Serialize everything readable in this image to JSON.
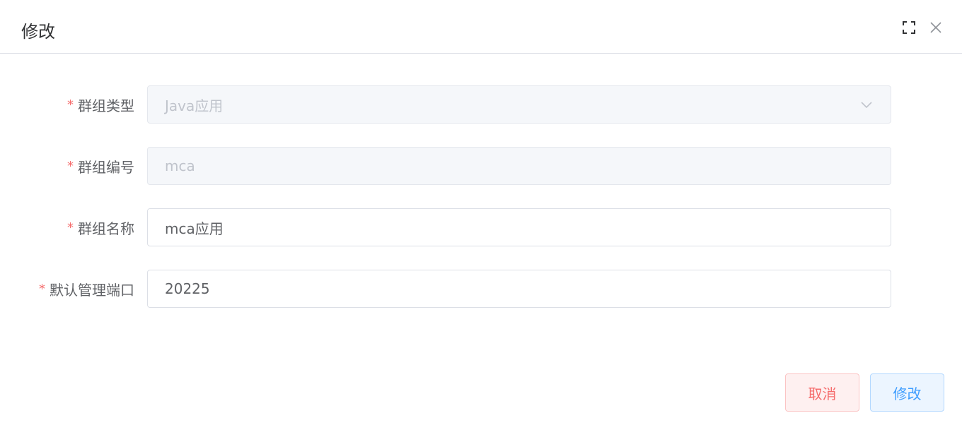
{
  "dialog": {
    "title": "修改",
    "header_icons": [
      "fullscreen-icon",
      "close-icon"
    ]
  },
  "form": {
    "fields": [
      {
        "required": "*",
        "label": "群组类型",
        "value": "Java应用",
        "type": "select",
        "disabled": true
      },
      {
        "required": "*",
        "label": "群组编号",
        "value": "mca",
        "type": "input",
        "disabled": true
      },
      {
        "required": "*",
        "label": "群组名称",
        "value": "mca应用",
        "type": "input",
        "disabled": false
      },
      {
        "required": "*",
        "label": "默认管理端口",
        "value": "20225",
        "type": "input",
        "disabled": false
      }
    ]
  },
  "footer": {
    "cancel_label": "取消",
    "submit_label": "修改"
  },
  "colors": {
    "required": "#f56c6c",
    "cancel": "#f56c6c",
    "submit": "#409eff",
    "disabled_bg": "#f5f7fa",
    "border": "#dcdfe6"
  }
}
